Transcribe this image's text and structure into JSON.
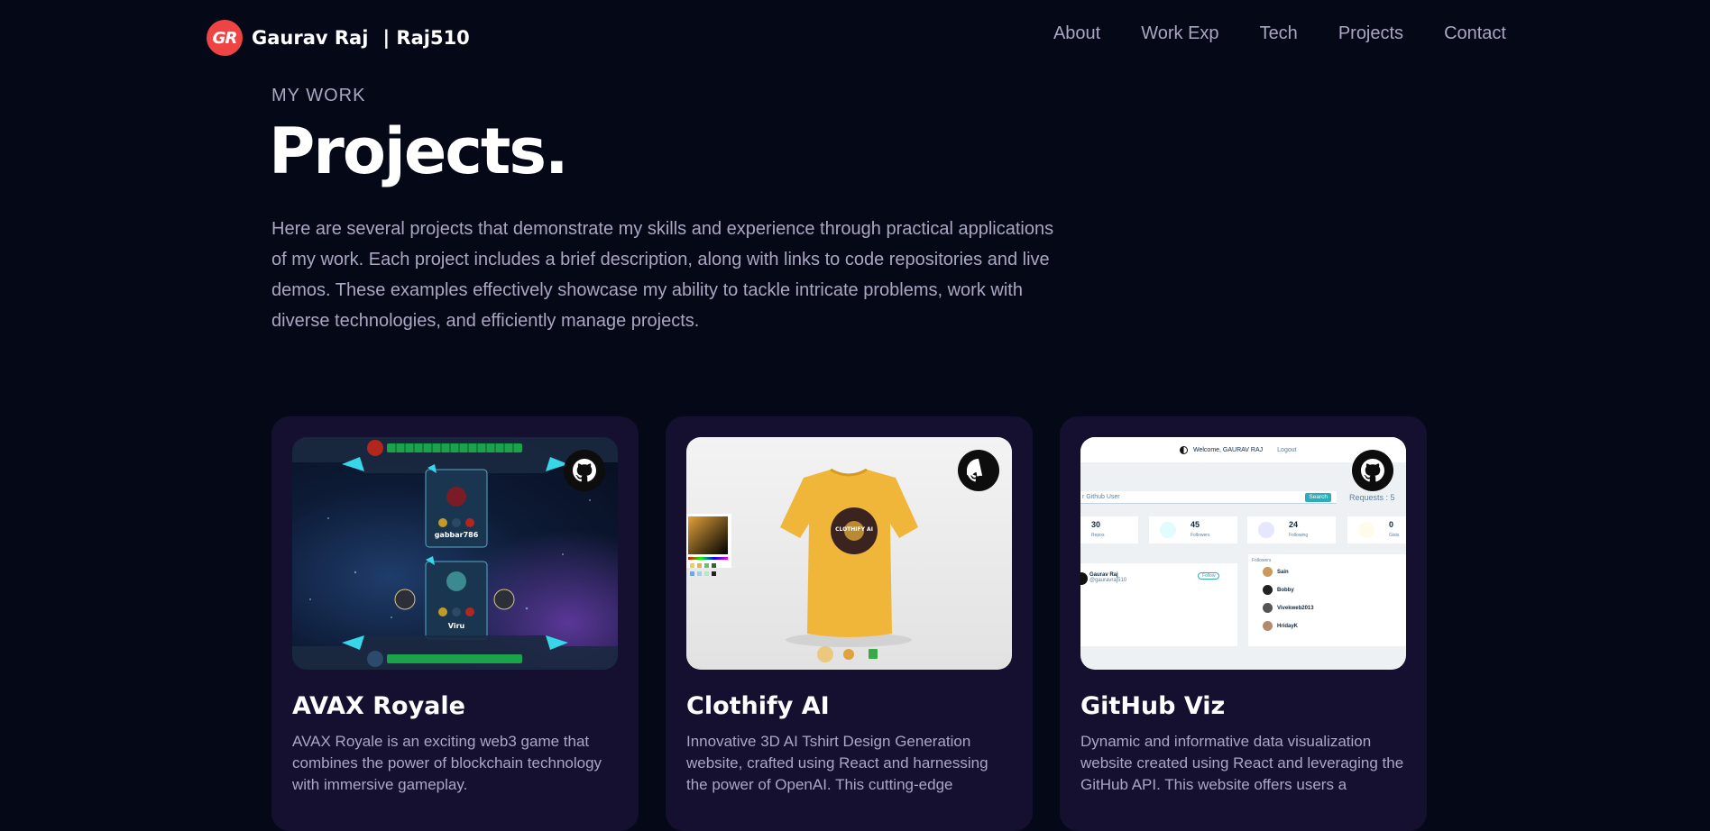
{
  "nav": {
    "logo_initials": "GR",
    "logo_name": "Gaurav Raj",
    "logo_handle": "| Raj510",
    "links": [
      "About",
      "Work Exp",
      "Tech",
      "Projects",
      "Contact"
    ]
  },
  "header": {
    "subtitle": "MY WORK",
    "title": "Projects.",
    "intro": "Here are several projects that demonstrate my skills and experience through practical applications of my work. Each project includes a brief description, along with links to code repositories and live demos. These examples effectively showcase my ability to tackle intricate problems, work with diverse technologies, and efficiently manage projects."
  },
  "projects": [
    {
      "name": "AVAX Royale",
      "description": "AVAX Royale is an exciting web3 game that combines the power of blockchain technology with immersive gameplay.",
      "thumb": {
        "player_top": "gabbar786",
        "player_bottom": "Viru"
      }
    },
    {
      "name": "Clothify AI",
      "description": "Innovative 3D AI Tshirt Design Generation website, crafted using React and harnessing the power of OpenAI. This cutting-edge",
      "thumb": {
        "logo_text": "CLOTHIFY AI"
      }
    },
    {
      "name": "GitHub Viz",
      "description": "Dynamic and informative data visualization website created using React and leveraging the GitHub API. This website offers users a",
      "thumb": {
        "welcome": "Welcome, GAURAV RAJ",
        "logout": "Logout",
        "search_placeholder": "r Github User",
        "search_button": "Search",
        "requests": "Requests : 5",
        "stats": [
          {
            "value": "30",
            "label": "Repos"
          },
          {
            "value": "45",
            "label": "Followers"
          },
          {
            "value": "24",
            "label": "Following"
          },
          {
            "value": "0",
            "label": "Gists"
          }
        ],
        "user_name": "Gaurav Raj",
        "user_handle": "@gauravraj510",
        "follow_button": "Follow",
        "followers_label": "Followers",
        "followers": [
          "Sain",
          "Bobby",
          "Vivekweb2013",
          "HridayK"
        ]
      }
    }
  ],
  "colors": {
    "background": "#050816",
    "card": "#151030",
    "secondary_text": "#aaa6c3",
    "logo_red": "#ef4444"
  }
}
